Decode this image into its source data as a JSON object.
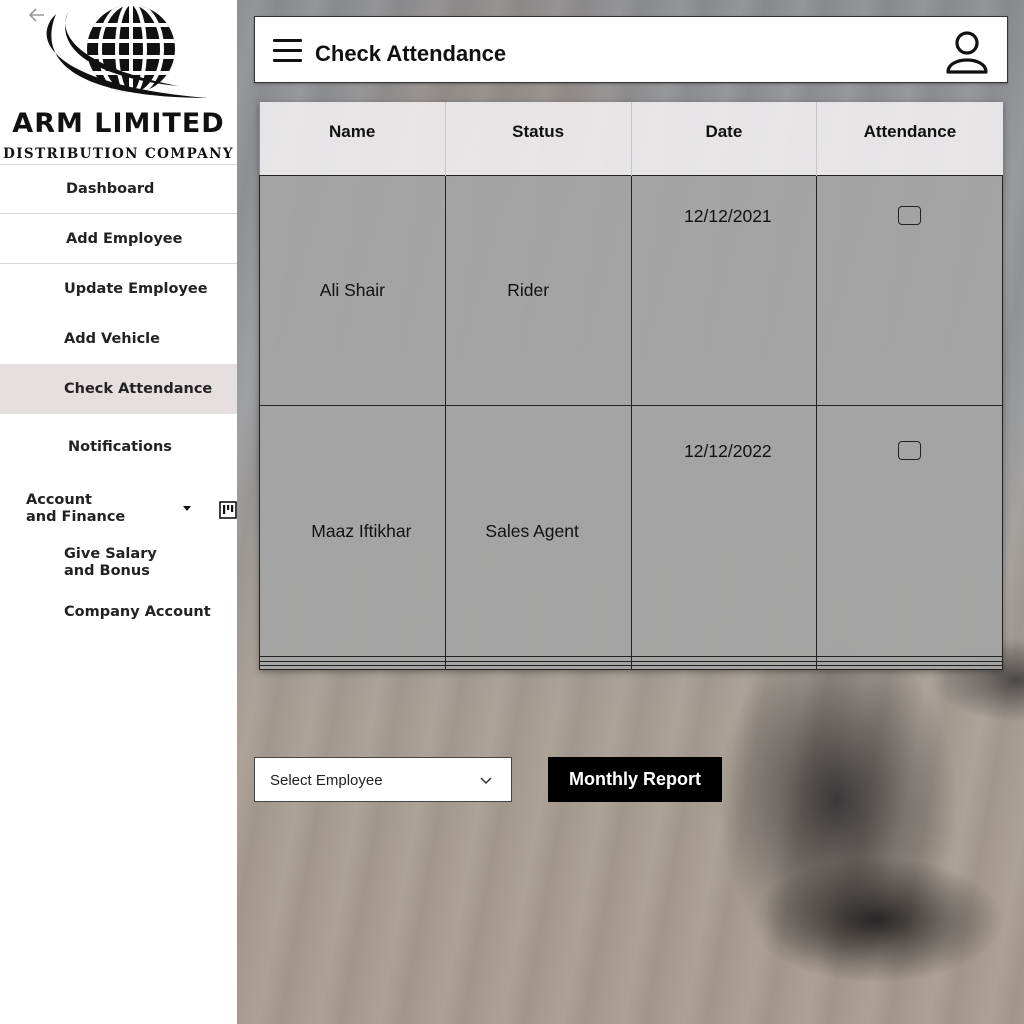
{
  "sidebar": {
    "logo": {
      "title": "ARM LIMITED",
      "subtitle": "DISTRIBUTION COMPANY"
    },
    "items": [
      {
        "label": "Dashboard"
      },
      {
        "label": "Add Employee"
      },
      {
        "label": "Update Employee"
      },
      {
        "label": "Add Vehicle"
      },
      {
        "label": "Check Attendance",
        "active": true
      },
      {
        "label": "Notifications"
      }
    ],
    "account_finance": {
      "label": "Account and Finance",
      "children": [
        {
          "label": "Give Salary and Bonus"
        },
        {
          "label": "Company Account"
        }
      ]
    }
  },
  "header": {
    "title": "Check Attendance"
  },
  "table": {
    "columns": [
      "Name",
      "Status",
      "Date",
      "Attendance"
    ],
    "rows": [
      {
        "name": "Ali Shair",
        "status": "Rider",
        "date": "12/12/2021",
        "attended": false
      },
      {
        "name": "Maaz Iftikhar",
        "status": "Sales Agent",
        "date": "12/12/2022",
        "attended": false
      }
    ]
  },
  "controls": {
    "select_employee": "Select Employee",
    "monthly_report": "Monthly Report"
  },
  "icons": {
    "logo": "globe-logo-icon",
    "collapse": "arrow-left-icon",
    "menu": "hamburger-menu-icon",
    "user": "user-icon",
    "caret": "caret-down-icon",
    "kanban": "kanban-icon",
    "dropdown": "chevron-down-icon",
    "checkbox": "checkbox-icon"
  }
}
